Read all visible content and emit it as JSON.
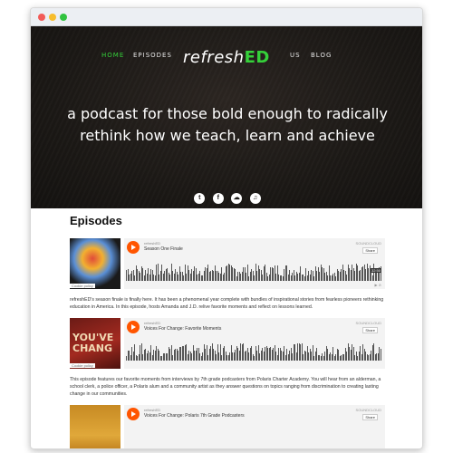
{
  "nav": {
    "home": "HOME",
    "episodes": "EPISODES",
    "logo_main": "refresh",
    "logo_accent": "ED",
    "us": "US",
    "blog": "BLOG"
  },
  "hero": {
    "tagline": "a podcast for those bold enough to radically rethink how we teach, learn and achieve",
    "socials": [
      "twitter-icon",
      "facebook-icon",
      "soundcloud-icon",
      "itunes-icon"
    ]
  },
  "section": {
    "title": "Episodes"
  },
  "episodes": [
    {
      "uploader": "refreshED",
      "track": "Season One Finale",
      "art_text": "",
      "duration": "32:50",
      "share_label": "Share",
      "cookie": "Cookie policy",
      "description": "refreshED's season finale is finally here. It has been a phenomenal year complete with bundles of inspirational stories from fearless pioneers rethinking education in America. In this episode, hosts Amanda and J.D. relive favorite moments and reflect on lessons learned."
    },
    {
      "uploader": "refreshED",
      "track": "Voices For Change: Favorite Moments",
      "art_text": "YOU'VE CHANG",
      "duration": "",
      "share_label": "Share",
      "cookie": "Cookie policy",
      "description": "This episode features our favorite moments from interviews by 7th grade podcasters from Polaris Charter Academy. You will hear from an alderman, a school clerk, a police officer, a Polaris alum and a community artist as they answer questions on topics ranging from discrimination to creating lasting change in our communities."
    },
    {
      "uploader": "refreshED",
      "track": "Voices For Change: Polaris 7th Grade Podcasters",
      "art_text": "",
      "duration": "",
      "share_label": "Share",
      "cookie": "",
      "description": ""
    }
  ],
  "soundcloud": {
    "label": "SOUNDCLOUD"
  },
  "colors": {
    "accent": "#35d13a",
    "play": "#ff5500"
  }
}
